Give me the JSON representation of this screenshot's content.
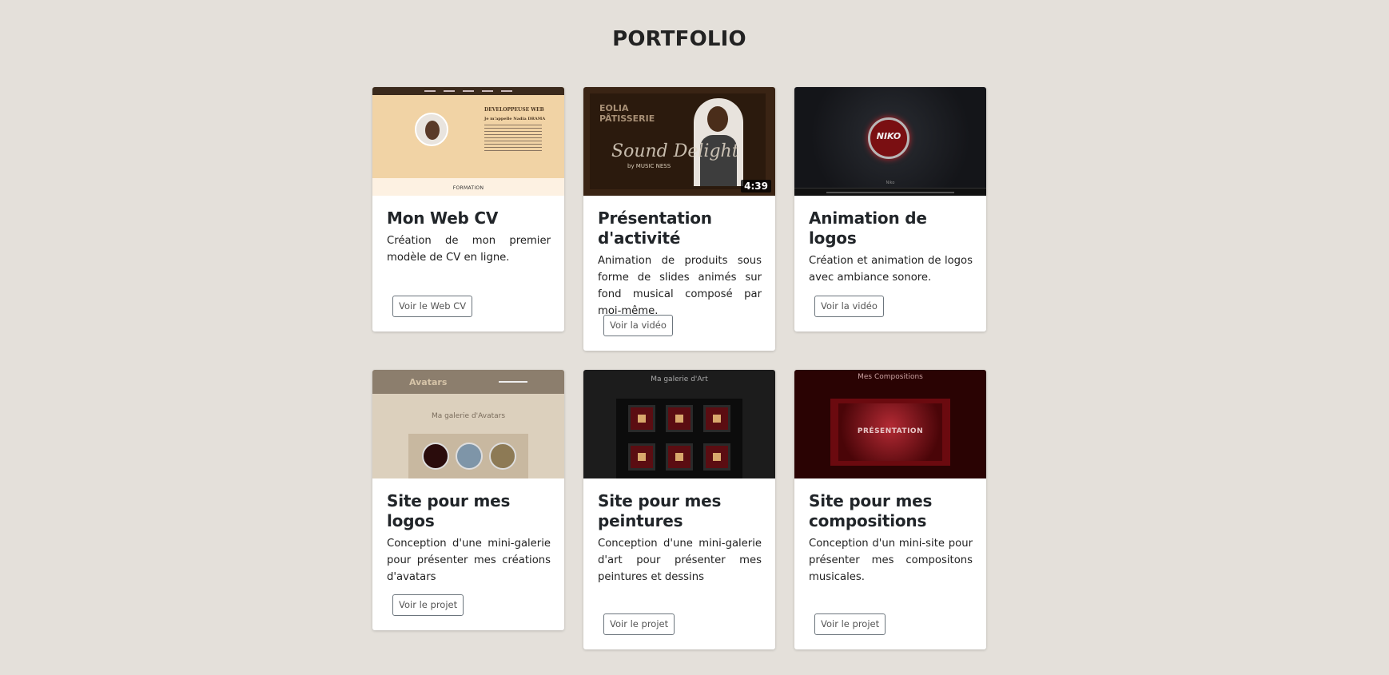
{
  "page": {
    "title": "PORTFOLIO"
  },
  "cards": [
    {
      "title": "Mon Web CV",
      "text": "Création de mon premier modèle de CV en ligne.",
      "button": "Voir le Web CV",
      "thumb": {
        "heading": "DEVELOPPEUSE WEB",
        "subheading": "Je m'appelle Nadia DRAMA",
        "footer": "FORMATION"
      }
    },
    {
      "title": "Présentation d'activité",
      "text": "Animation de produits sous forme de slides animés sur fond musical composé par moi-même.",
      "button": "Voir la vidéo",
      "thumb": {
        "brand": "EOLIA PÂTISSERIE",
        "overlay": "Sound Delight",
        "byline": "by MUSIC NESS",
        "duration": "4:39"
      }
    },
    {
      "title": "Animation de logos",
      "text": "Création et animation de logos avec ambiance sonore.",
      "button": "Voir la vidéo",
      "thumb": {
        "logo": "NIKO",
        "label": "Niko"
      }
    },
    {
      "title": "Site pour mes logos",
      "text": "Conception d'une mini-galerie pour présenter mes créations d'avatars",
      "button": "Voir le projet",
      "thumb": {
        "brand": "Avatars",
        "caption": "Ma galerie d'Avatars"
      }
    },
    {
      "title": "Site pour mes peintures",
      "text": "Conception d'une mini-galerie d'art pour présenter mes peintures et dessins",
      "button": "Voir le projet",
      "thumb": {
        "caption": "Ma galerie d'Art"
      }
    },
    {
      "title": "Site pour mes compositions",
      "text": "Conception d'un mini-site pour présenter mes compositons musicales.",
      "button": "Voir le projet",
      "thumb": {
        "caption": "Mes Compositions",
        "overlay": "PRÉSENTATION"
      }
    }
  ]
}
